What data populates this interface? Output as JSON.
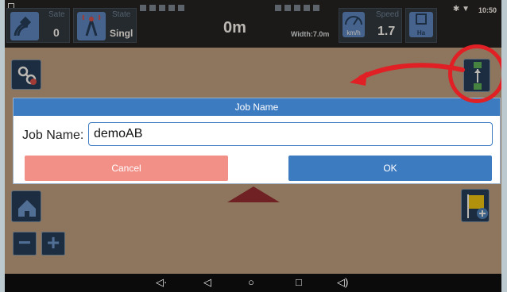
{
  "status_bar": {
    "clock": "10:50",
    "bluetooth_icon": "bluetooth-icon",
    "wifi_icon": "wifi-icon"
  },
  "top_bar": {
    "sate_label": "Sate",
    "sate_value": "0",
    "state_label": "State",
    "state_value": "Singl",
    "distance": "0m",
    "width_text": "Width:7.0m",
    "speed_label": "Speed",
    "speed_unit": "km/h",
    "speed_value": "1.7",
    "area_unit": "Ha"
  },
  "dialog": {
    "title": "Job Name",
    "field_label": "Job Name:",
    "field_value": "demoAB",
    "cancel_label": "Cancel",
    "ok_label": "OK"
  },
  "map_buttons": {
    "zoom_out": "−",
    "zoom_in": "+"
  },
  "colors": {
    "accent": "#3d7bc1",
    "cancel": "#f29088",
    "annotation": "#e02024",
    "field": "#b89c7d"
  }
}
